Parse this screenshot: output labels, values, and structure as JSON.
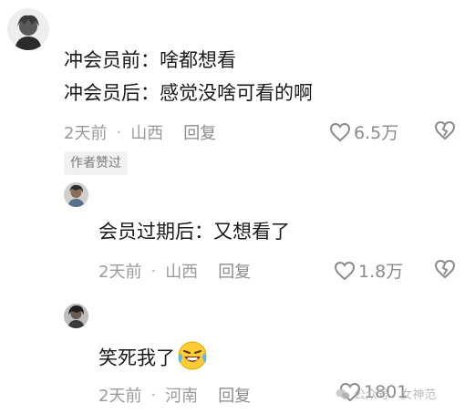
{
  "comments": [
    {
      "lines": [
        "冲会员前：啥都想看",
        "冲会员后：感觉没啥可看的啊"
      ],
      "time": "2天前",
      "location": "山西",
      "reply_label": "回复",
      "likes": "6.5万",
      "author_badge": "作者赞过"
    },
    {
      "text": "会员过期后：又想看了",
      "time": "2天前",
      "location": "山西",
      "reply_label": "回复",
      "likes": "1.8万"
    },
    {
      "text": "笑死我了",
      "time": "2天前",
      "location": "河南",
      "reply_label": "回复",
      "likes": "1801"
    }
  ],
  "watermark": "公众号 · 女神范",
  "icons": [
    "heart-icon",
    "broken-heart-icon",
    "laughing-crying-emoji"
  ]
}
